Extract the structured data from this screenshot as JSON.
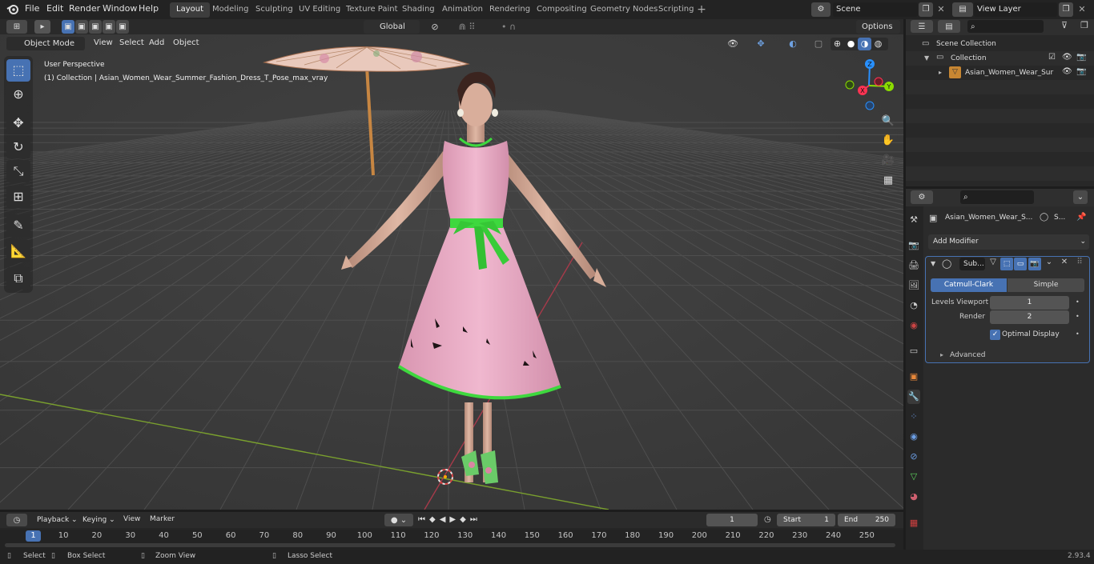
{
  "menu": {
    "file": "File",
    "edit": "Edit",
    "render": "Render",
    "window": "Window",
    "help": "Help"
  },
  "workspaces": [
    "Layout",
    "Modeling",
    "Sculpting",
    "UV Editing",
    "Texture Paint",
    "Shading",
    "Animation",
    "Rendering",
    "Compositing",
    "Geometry Nodes",
    "Scripting"
  ],
  "scene": {
    "name": "Scene",
    "view_layer": "View Layer"
  },
  "toolheader": {
    "transform": "Global",
    "options": "Options"
  },
  "viewport_header": {
    "mode": "Object Mode",
    "view": "View",
    "select": "Select",
    "add": "Add",
    "object": "Object"
  },
  "overlay": {
    "perspective": "User Perspective",
    "collection_label": "(1) Collection | Asian_Women_Wear_Summer_Fashion_Dress_T_Pose_max_vray"
  },
  "gizmo": {
    "x": "X",
    "y": "Y",
    "z": "Z"
  },
  "outliner": {
    "scene_collection": "Scene Collection",
    "collection": "Collection",
    "object": "Asian_Women_Wear_Sur"
  },
  "properties": {
    "object_name": "Asian_Women_Wear_S...",
    "modifier_short": "S...",
    "add_modifier": "Add Modifier",
    "modifier_name": "Sub...",
    "tab_catmull": "Catmull-Clark",
    "tab_simple": "Simple",
    "levels_label": "Levels Viewport",
    "levels_value": "1",
    "render_label": "Render",
    "render_value": "2",
    "optimal": "Optimal Display",
    "advanced": "Advanced"
  },
  "timeline": {
    "playback": "Playback",
    "keying": "Keying",
    "view": "View",
    "marker": "Marker",
    "current": "1",
    "start_label": "Start",
    "start": "1",
    "end_label": "End",
    "end": "250",
    "frames": [
      "1",
      "10",
      "20",
      "30",
      "40",
      "50",
      "60",
      "70",
      "80",
      "90",
      "100",
      "110",
      "120",
      "130",
      "140",
      "150",
      "160",
      "170",
      "180",
      "190",
      "200",
      "210",
      "220",
      "230",
      "240",
      "250"
    ]
  },
  "status": {
    "select": "Select",
    "box": "Box Select",
    "zoom": "Zoom View",
    "lasso": "Lasso Select",
    "version": "2.93.4"
  },
  "colors": {
    "accent": "#4772b3",
    "dress": "#e7a7c2",
    "sash": "#3ed83e",
    "x_axis": "#ff3352",
    "y_axis": "#8bdc00",
    "z_axis": "#2890ff"
  }
}
